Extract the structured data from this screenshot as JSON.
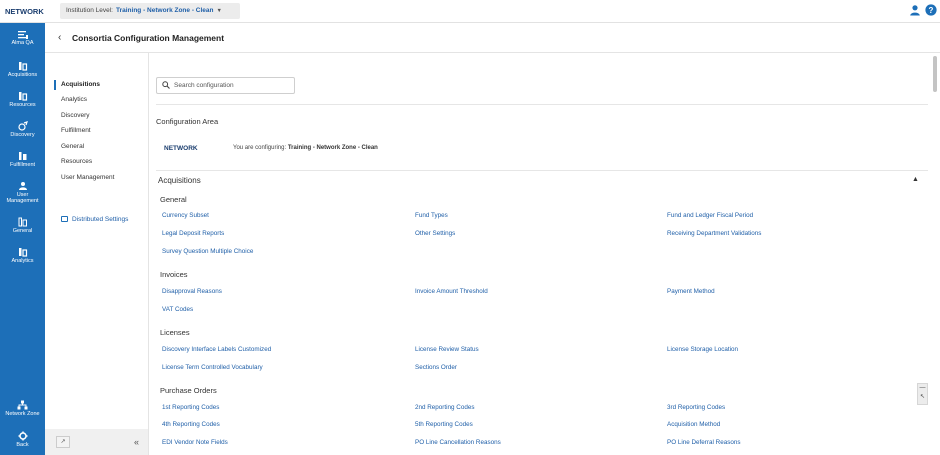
{
  "topbar": {
    "brand": "NETWORK",
    "institution_label": "Institution Level:",
    "institution_value": "Training - Network Zone - Clean",
    "user_icon": "user-icon",
    "help_icon": "help-icon"
  },
  "leftnav": {
    "items": [
      {
        "label": "Alma QA",
        "icon": "menu-icon"
      },
      {
        "label": "Acquisitions",
        "icon": "acquisitions-icon"
      },
      {
        "label": "Resources",
        "icon": "resources-icon"
      },
      {
        "label": "Discovery",
        "icon": "discovery-icon"
      },
      {
        "label": "Fulfillment",
        "icon": "fulfillment-icon"
      },
      {
        "label": "User Management",
        "label_line1": "User",
        "label_line2": "Management",
        "icon": "user-management-icon"
      },
      {
        "label": "General",
        "icon": "general-icon"
      },
      {
        "label": "Analytics",
        "icon": "analytics-icon"
      }
    ],
    "bottom": [
      {
        "label": "Network Zone",
        "icon": "network-zone-icon"
      },
      {
        "label": "Back",
        "icon": "back-icon"
      }
    ]
  },
  "header": {
    "title": "Consortia Configuration Management"
  },
  "subnav": {
    "items": [
      "Acquisitions",
      "Analytics",
      "Discovery",
      "Fulfillment",
      "General",
      "Resources",
      "User Management"
    ],
    "active": "Acquisitions",
    "distributed": "Distributed Settings"
  },
  "main": {
    "search_placeholder": "Search configuration",
    "config_area": "Configuration Area",
    "network_label": "NETWORK",
    "configuring_prefix": "You are configuring:",
    "configuring_value": "Training - Network Zone - Clean",
    "acq_title": "Acquisitions",
    "sections": {
      "general": {
        "title": "General",
        "links": [
          "Currency Subset",
          "Fund Types",
          "Fund and Ledger Fiscal Period",
          "Legal Deposit Reports",
          "Other Settings",
          "Receiving Department Validations",
          "Survey Question Multiple Choice"
        ]
      },
      "invoices": {
        "title": "Invoices",
        "links": [
          "Disapproval Reasons",
          "Invoice Amount Threshold",
          "Payment Method",
          "VAT Codes"
        ]
      },
      "licenses": {
        "title": "Licenses",
        "links": [
          "Discovery Interface Labels Customized",
          "License Review Status",
          "License Storage Location",
          "License Term Controlled Vocabulary",
          "Sections Order"
        ]
      },
      "purchase_orders": {
        "title": "Purchase Orders",
        "links": [
          "1st Reporting Codes",
          "2nd Reporting Codes",
          "3rd Reporting Codes",
          "4th Reporting Codes",
          "5th Reporting Codes",
          "Acquisition Method",
          "EDI Vendor Note Fields",
          "PO Line Cancellation Reasons",
          "PO Line Deferral Reasons"
        ]
      }
    }
  },
  "colors": {
    "nav_bg": "#1d6fb8",
    "link": "#1f5fa8",
    "brand": "#1a3d6e"
  }
}
